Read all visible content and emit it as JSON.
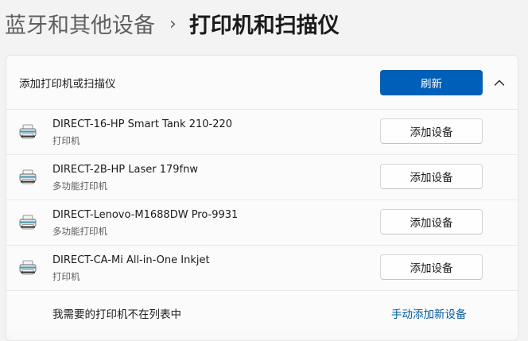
{
  "breadcrumb": {
    "parent": "蓝牙和其他设备",
    "separator": "›",
    "current": "打印机和扫描仪"
  },
  "add_section": {
    "title": "添加打印机或扫描仪",
    "refresh_label": "刷新",
    "collapse_icon": "chevron-up-icon"
  },
  "devices": [
    {
      "name": "DIRECT-16-HP Smart Tank 210-220",
      "type": "打印机",
      "button": "添加设备",
      "icon": "printer-icon"
    },
    {
      "name": "DIRECT-2B-HP Laser 179fnw",
      "type": "多功能打印机",
      "button": "添加设备",
      "icon": "printer-icon"
    },
    {
      "name": "DIRECT-Lenovo-M1688DW Pro-9931",
      "type": "多功能打印机",
      "button": "添加设备",
      "icon": "printer-icon"
    },
    {
      "name": "DIRECT-CA-Mi All-in-One Inkjet",
      "type": "打印机",
      "button": "添加设备",
      "icon": "printer-icon"
    }
  ],
  "footer": {
    "text": "我需要的打印机不在列表中",
    "link": "手动添加新设备"
  },
  "colors": {
    "accent": "#005fb8",
    "link": "#005a9e",
    "background": "#f3f3f3",
    "card": "#fbfbfb"
  }
}
